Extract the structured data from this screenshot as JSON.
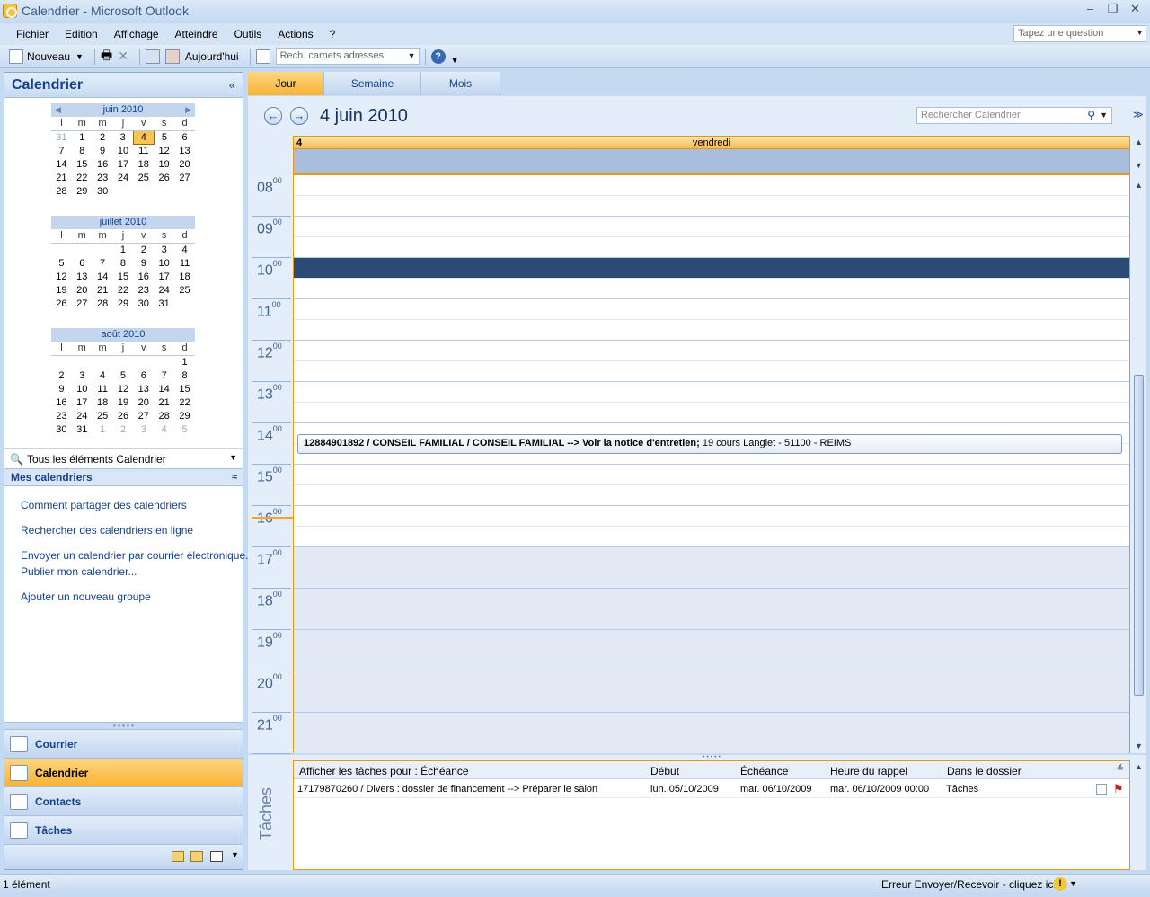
{
  "window": {
    "title": "Calendrier - Microsoft Outlook"
  },
  "menu": {
    "items": [
      "Fichier",
      "Edition",
      "Affichage",
      "Atteindre",
      "Outils",
      "Actions",
      "?"
    ],
    "ask_placeholder": "Tapez une question"
  },
  "toolbar": {
    "new_label": "Nouveau",
    "today_label": "Aujourd'hui",
    "address_search_placeholder": "Rech. carnets adresses"
  },
  "nav": {
    "title": "Calendrier",
    "collapse_icon": "«",
    "months": [
      {
        "title": "juin 2010",
        "weekdays": [
          "l",
          "m",
          "m",
          "j",
          "v",
          "s",
          "d"
        ],
        "weeks": [
          [
            "31",
            "1",
            "2",
            "3",
            "4",
            "5",
            "6"
          ],
          [
            "7",
            "8",
            "9",
            "10",
            "11",
            "12",
            "13"
          ],
          [
            "14",
            "15",
            "16",
            "17",
            "18",
            "19",
            "20"
          ],
          [
            "21",
            "22",
            "23",
            "24",
            "25",
            "26",
            "27"
          ],
          [
            "28",
            "29",
            "30",
            "",
            "",
            "",
            ""
          ]
        ],
        "other_month": [
          "0-0"
        ],
        "today": "0-4"
      },
      {
        "title": "juillet 2010",
        "weekdays": [
          "l",
          "m",
          "m",
          "j",
          "v",
          "s",
          "d"
        ],
        "weeks": [
          [
            "",
            "",
            "",
            "1",
            "2",
            "3",
            "4"
          ],
          [
            "5",
            "6",
            "7",
            "8",
            "9",
            "10",
            "11"
          ],
          [
            "12",
            "13",
            "14",
            "15",
            "16",
            "17",
            "18"
          ],
          [
            "19",
            "20",
            "21",
            "22",
            "23",
            "24",
            "25"
          ],
          [
            "26",
            "27",
            "28",
            "29",
            "30",
            "31",
            ""
          ]
        ],
        "other_month": [],
        "today": ""
      },
      {
        "title": "août 2010",
        "weekdays": [
          "l",
          "m",
          "m",
          "j",
          "v",
          "s",
          "d"
        ],
        "weeks": [
          [
            "",
            "",
            "",
            "",
            "",
            "",
            "1"
          ],
          [
            "2",
            "3",
            "4",
            "5",
            "6",
            "7",
            "8"
          ],
          [
            "9",
            "10",
            "11",
            "12",
            "13",
            "14",
            "15"
          ],
          [
            "16",
            "17",
            "18",
            "19",
            "20",
            "21",
            "22"
          ],
          [
            "23",
            "24",
            "25",
            "26",
            "27",
            "28",
            "29"
          ],
          [
            "30",
            "31",
            "1",
            "2",
            "3",
            "4",
            "5"
          ]
        ],
        "other_month": [
          "5-2",
          "5-3",
          "5-4",
          "5-5",
          "5-6"
        ],
        "today": ""
      }
    ],
    "filter_label": "Tous les éléments Calendrier",
    "my_calendars_label": "Mes calendriers",
    "links": [
      "Comment partager des calendriers",
      "Rechercher des calendriers en ligne",
      "Envoyer un calendrier par courrier électronique...",
      "Publier mon calendrier...",
      "Ajouter un nouveau groupe"
    ],
    "buttons": [
      {
        "label": "Courrier",
        "icon": "mail-icon"
      },
      {
        "label": "Calendrier",
        "icon": "calendar-icon"
      },
      {
        "label": "Contacts",
        "icon": "contacts-icon"
      },
      {
        "label": "Tâches",
        "icon": "tasks-icon"
      }
    ]
  },
  "view_tabs": [
    "Jour",
    "Semaine",
    "Mois"
  ],
  "day_view": {
    "date_title": "4 juin 2010",
    "search_placeholder": "Rechercher Calendrier",
    "day_number": "4",
    "day_name": "vendredi",
    "hours": [
      "08",
      "09",
      "10",
      "11",
      "12",
      "13",
      "14",
      "15",
      "16",
      "17",
      "18",
      "19",
      "20",
      "21"
    ],
    "minutes_label": "00",
    "selected_slot_hour": 10,
    "appointment": {
      "bold_text": "12884901892 / CONSEIL FAMILIAL /  CONSEIL FAMILIAL --> Voir la notice d'entretien;",
      "location": " 19 cours Langlet - 51100 - REIMS"
    }
  },
  "tasks": {
    "pane_label": "Tâches",
    "columns": [
      "Afficher les tâches pour : Échéance",
      "Début",
      "Échéance",
      "Heure du rappel",
      "Dans le dossier"
    ],
    "rows": [
      [
        "17179870260 / Divers : dossier de financement --> Préparer le salon",
        "lun. 05/10/2009",
        "mar. 06/10/2009",
        "mar. 06/10/2009 00:00",
        "Tâches"
      ]
    ]
  },
  "status": {
    "count": "1 élément",
    "send_receive": "Erreur Envoyer/Recevoir - cliquez ici"
  }
}
